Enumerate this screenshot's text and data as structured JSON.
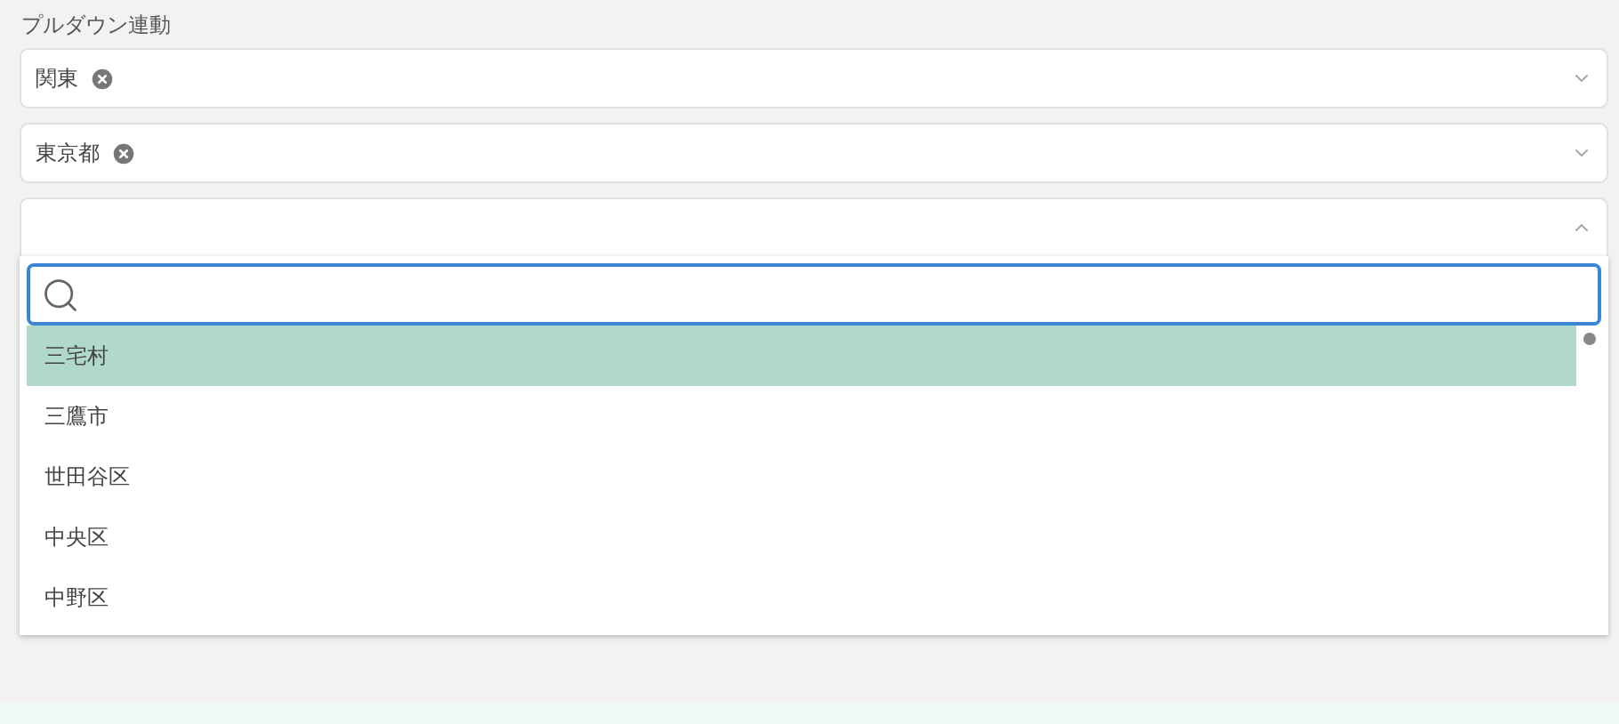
{
  "label": "プルダウン連動",
  "selects": [
    {
      "chips": [
        "関東"
      ],
      "expanded": false
    },
    {
      "chips": [
        "東京都"
      ],
      "expanded": false
    },
    {
      "expanded": true
    }
  ],
  "dropdown": {
    "options": [
      {
        "label": "三宅村",
        "selected": true
      },
      {
        "label": "三鷹市",
        "selected": false
      },
      {
        "label": "世田谷区",
        "selected": false
      },
      {
        "label": "中央区",
        "selected": false
      },
      {
        "label": "中野区",
        "selected": false
      }
    ]
  }
}
